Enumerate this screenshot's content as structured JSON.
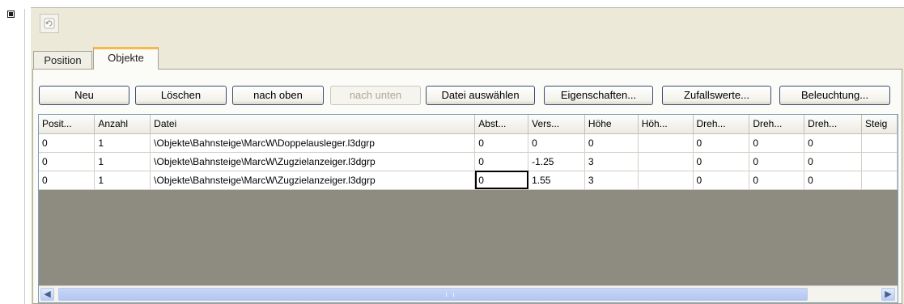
{
  "tabs": [
    "Position",
    "Objekte"
  ],
  "toolbar": {
    "new": "Neu",
    "delete": "Löschen",
    "up": "nach oben",
    "down": "nach unten",
    "choose_file": "Datei auswählen",
    "properties": "Eigenschaften...",
    "random": "Zufallswerte...",
    "lighting": "Beleuchtung..."
  },
  "table": {
    "columns": [
      "Posit...",
      "Anzahl",
      "Datei",
      "Abst...",
      "Vers...",
      "Höhe",
      "Höh...",
      "Dreh...",
      "Dreh...",
      "Dreh...",
      "Steig"
    ],
    "rows": [
      [
        "0",
        "1",
        "\\Objekte\\Bahnsteige\\MarcW\\Doppelausleger.l3dgrp",
        "0",
        "0",
        "0",
        "",
        "0",
        "0",
        "0",
        ""
      ],
      [
        "0",
        "1",
        "\\Objekte\\Bahnsteige\\MarcW\\Zugzielanzeiger.l3dgrp",
        "0",
        "-1.25",
        "3",
        "",
        "0",
        "0",
        "0",
        ""
      ],
      [
        "0",
        "1",
        "\\Objekte\\Bahnsteige\\MarcW\\Zugzielanzeiger.l3dgrp",
        "0",
        "1.55",
        "3",
        "",
        "0",
        "0",
        "0",
        ""
      ]
    ],
    "selected_cell": "Abst... (row 3)"
  },
  "icons": {
    "collapse": "collapse-box-icon",
    "refresh": "refresh-icon",
    "scroll_left": "arrow-left-icon",
    "scroll_right": "arrow-right-icon"
  },
  "colors": {
    "tab_accent": "#f8b84c",
    "panel_bg": "#ece9d8",
    "empty_grid_bg": "#8e8c80",
    "scrollbar": "#b9cdf5"
  }
}
